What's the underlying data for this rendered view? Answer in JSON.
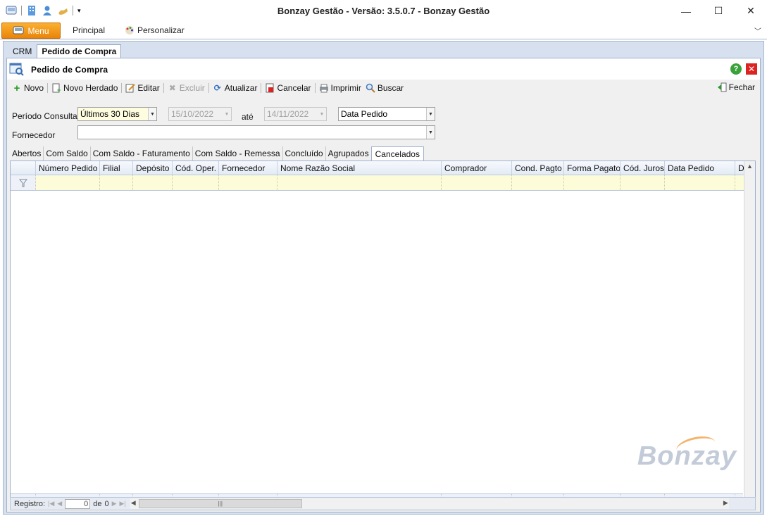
{
  "window": {
    "title": "Bonzay Gestão - Versão: 3.5.0.7 - Bonzay Gestão",
    "controls": [
      "minimize-icon",
      "maximize-icon",
      "close-icon"
    ]
  },
  "ribbon": {
    "menu_label": "Menu",
    "tabs": [
      "Principal",
      "Personalizar"
    ]
  },
  "doc_tabs": [
    "CRM",
    "Pedido de Compra"
  ],
  "page": {
    "title": "Pedido de Compra"
  },
  "toolbar": {
    "novo": "Novo",
    "novo_herdado": "Novo Herdado",
    "editar": "Editar",
    "excluir": "Excluir",
    "atualizar": "Atualizar",
    "cancelar": "Cancelar",
    "imprimir": "Imprimir",
    "buscar": "Buscar",
    "fechar": "Fechar"
  },
  "filters": {
    "periodo_label": "Período Consulta",
    "periodo_value": "Últimos 30 Dias",
    "date_from": "15/10/2022",
    "ate_label": "até",
    "date_to": "14/11/2022",
    "date_field": "Data Pedido",
    "fornecedor_label": "Fornecedor",
    "fornecedor_value": ""
  },
  "grid_tabs": [
    "Abertos",
    "Com Saldo",
    "Com Saldo - Faturamento",
    "Com Saldo - Remessa",
    "Concluído",
    "Agrupados",
    "Cancelados"
  ],
  "active_grid_tab": "Cancelados",
  "columns": [
    "Número Pedido",
    "Filial",
    "Depósito",
    "Cód. Oper.",
    "Fornecedor",
    "Nome Razão Social",
    "Comprador",
    "Cond. Pagto",
    "Forma Pagato",
    "Cód. Juros",
    "Data Pedido",
    "Data"
  ],
  "watermark": "Bonzay",
  "status": {
    "registro_label": "Registro:",
    "record_value": "0",
    "de_label": "de",
    "total": "0"
  }
}
